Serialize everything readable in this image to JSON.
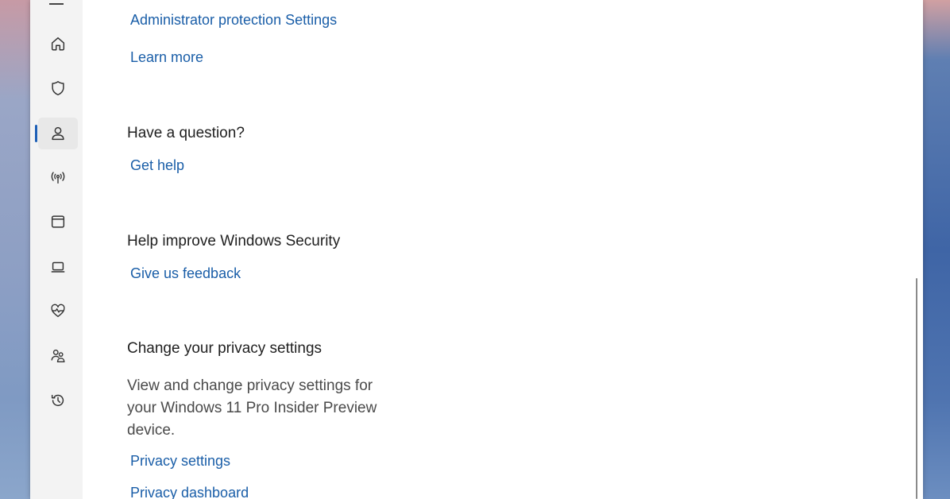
{
  "sidebar": {
    "items": [
      {
        "name": "home-icon"
      },
      {
        "name": "shield-icon"
      },
      {
        "name": "account-icon",
        "selected": true
      },
      {
        "name": "network-icon"
      },
      {
        "name": "app-browser-icon"
      },
      {
        "name": "laptop-icon"
      },
      {
        "name": "health-heart-icon"
      },
      {
        "name": "family-icon"
      },
      {
        "name": "history-icon"
      }
    ]
  },
  "main": {
    "admin_protection_link": "Administrator protection Settings",
    "learn_more_link": "Learn more",
    "question_heading": "Have a question?",
    "get_help_link": "Get help",
    "improve_heading": "Help improve Windows Security",
    "feedback_link": "Give us feedback",
    "privacy_heading": "Change your privacy settings",
    "privacy_description": "View and change privacy settings for your Windows 11 Pro Insider Preview device.",
    "privacy_settings_link": "Privacy settings",
    "privacy_dashboard_link": "Privacy dashboard"
  },
  "colors": {
    "link": "#1a5ea8",
    "accent": "#1d5fb6"
  }
}
